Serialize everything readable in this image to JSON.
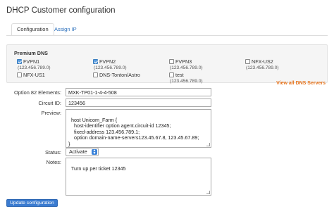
{
  "page": {
    "title": "DHCP Customer configuration"
  },
  "tabs": [
    {
      "label": "Configuration"
    },
    {
      "label": "Assign IP"
    }
  ],
  "premium_dns": {
    "title": "Premium DNS",
    "items": [
      {
        "name": "FVPN1",
        "ip": "(123.456.789.0)",
        "checked": true
      },
      {
        "name": "FVPN2",
        "ip": "(123.456.789.0)",
        "checked": true
      },
      {
        "name": "FVPN3",
        "ip": "(123.456.789.0)",
        "checked": false
      },
      {
        "name": "NFX-US2",
        "ip": "(123.456.789.0)",
        "checked": false
      },
      {
        "name": "NFX-US1",
        "ip": "",
        "checked": false
      },
      {
        "name": "DNS-Tonton/Astro",
        "ip": "",
        "checked": false
      },
      {
        "name": "test",
        "ip": "(123.456.789.0)",
        "checked": false
      }
    ],
    "view_all": "View all DNS Servers"
  },
  "form": {
    "option82": {
      "label": "Option 82 Elements:",
      "value": "MXK-TP01-1-4-4-508"
    },
    "circuit_id": {
      "label": "Circuit ID:",
      "value": "123456"
    },
    "preview": {
      "label": "Preview:",
      "value": "host Unicom_Farm {\n    host-identifier option agent.circuit-id 12345;\n    fixed-address 123.456.789.1;\n    option domain-name-servers123.45.67.8, 123.45.67.89;\n}"
    },
    "status": {
      "label": "Status:",
      "value": "Activate"
    },
    "notes": {
      "label": "Notes:",
      "value": "Turn up per ticket 12345"
    },
    "submit_label": "Update configuration"
  }
}
